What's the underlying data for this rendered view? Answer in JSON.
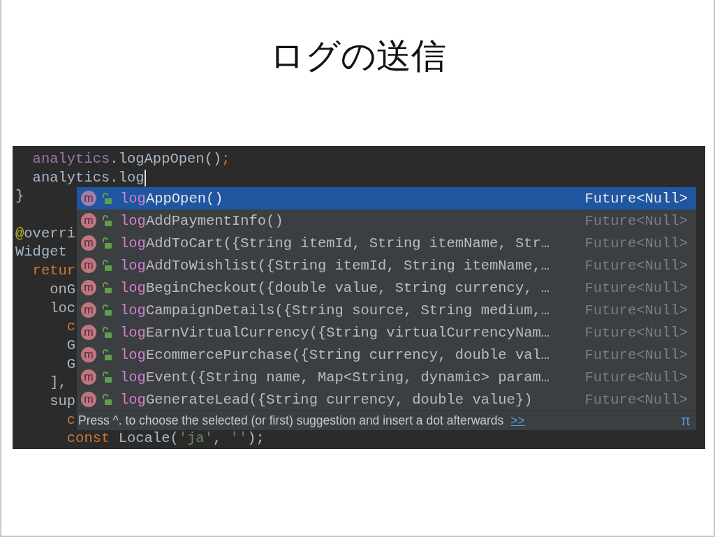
{
  "slide": {
    "title": "ログの送信"
  },
  "editor": {
    "lines": [
      {
        "tokens": [
          {
            "text": "  analytics",
            "kind": "field"
          },
          {
            "text": ".logAppOpen()",
            "kind": "plain"
          },
          {
            "text": ";",
            "kind": "keyword"
          }
        ]
      },
      {
        "tokens": [
          {
            "text": "  analytics",
            "kind": "plain"
          },
          {
            "text": ".log",
            "kind": "plain"
          }
        ],
        "caret": true
      },
      {
        "tokens": [
          {
            "text": "}",
            "kind": "plain"
          }
        ]
      },
      {
        "gap_before": true,
        "tokens": [
          {
            "text": "@",
            "kind": "annotation"
          },
          {
            "text": "overri",
            "kind": "plain"
          }
        ]
      },
      {
        "tokens": [
          {
            "text": "Widget",
            "kind": "plain"
          }
        ]
      },
      {
        "tokens": [
          {
            "text": "  retur",
            "kind": "keyword"
          }
        ]
      },
      {
        "tokens": [
          {
            "text": "    onG",
            "kind": "plain"
          }
        ]
      },
      {
        "tokens": [
          {
            "text": "    loc",
            "kind": "plain"
          }
        ]
      },
      {
        "tokens": [
          {
            "text": "      c",
            "kind": "keyword"
          }
        ]
      },
      {
        "tokens": [
          {
            "text": "      G",
            "kind": "plain"
          }
        ]
      },
      {
        "tokens": [
          {
            "text": "      G",
            "kind": "plain"
          }
        ]
      },
      {
        "tokens": [
          {
            "text": "    ],",
            "kind": "plain"
          }
        ]
      },
      {
        "tokens": [
          {
            "text": "    sup",
            "kind": "plain"
          }
        ]
      },
      {
        "tokens": [
          {
            "text": "      c",
            "kind": "keyword"
          }
        ]
      },
      {
        "tokens": [
          {
            "text": "      const",
            "kind": "keyword"
          },
          {
            "text": " Locale(",
            "kind": "plain"
          },
          {
            "text": "'ja'",
            "kind": "string"
          },
          {
            "text": ", ",
            "kind": "plain"
          },
          {
            "text": "''",
            "kind": "string"
          },
          {
            "text": ");",
            "kind": "plain"
          }
        ]
      }
    ]
  },
  "completion": {
    "items": [
      {
        "icon": "m",
        "match": "log",
        "rest": "AppOpen()",
        "type": "Future<Null>",
        "selected": true
      },
      {
        "icon": "m",
        "match": "log",
        "rest": "AddPaymentInfo()",
        "type": "Future<Null>",
        "selected": false
      },
      {
        "icon": "m",
        "match": "log",
        "rest": "AddToCart({String itemId, String itemName, Str…",
        "type": "Future<Null>",
        "selected": false
      },
      {
        "icon": "m",
        "match": "log",
        "rest": "AddToWishlist({String itemId, String itemName,…",
        "type": "Future<Null>",
        "selected": false
      },
      {
        "icon": "m",
        "match": "log",
        "rest": "BeginCheckout({double value, String currency, …",
        "type": "Future<Null>",
        "selected": false
      },
      {
        "icon": "m",
        "match": "log",
        "rest": "CampaignDetails({String source, String medium,…",
        "type": "Future<Null>",
        "selected": false
      },
      {
        "icon": "m",
        "match": "log",
        "rest": "EarnVirtualCurrency({String virtualCurrencyNam…",
        "type": "Future<Null>",
        "selected": false
      },
      {
        "icon": "m",
        "match": "log",
        "rest": "EcommercePurchase({String currency, double val…",
        "type": "Future<Null>",
        "selected": false
      },
      {
        "icon": "m",
        "match": "log",
        "rest": "Event({String name, Map<String, dynamic> param…",
        "type": "Future<Null>",
        "selected": false
      },
      {
        "icon": "m",
        "match": "log",
        "rest": "GenerateLead({String currency, double value})",
        "type": "Future<Null>",
        "selected": false
      }
    ],
    "footer": {
      "hint": "Press ^. to choose the selected (or first) suggestion and insert a dot afterwards",
      "link": ">>",
      "pi": "π"
    }
  }
}
